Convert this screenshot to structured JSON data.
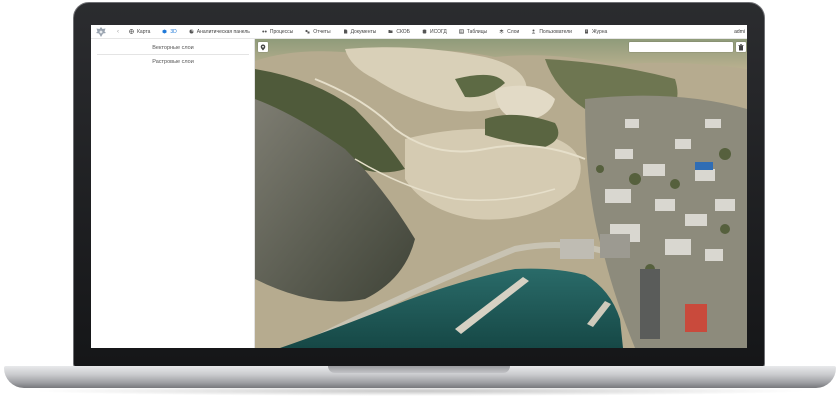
{
  "nav": {
    "items": [
      {
        "label": "Карта",
        "icon": "globe-icon",
        "active": false
      },
      {
        "label": "3D",
        "icon": "cube-icon",
        "active": true
      },
      {
        "label": "Аналитическая панель",
        "icon": "chart-icon",
        "active": false
      },
      {
        "label": "Процессы",
        "icon": "process-icon",
        "active": false
      },
      {
        "label": "Отчеты",
        "icon": "report-icon",
        "active": false
      },
      {
        "label": "Документы",
        "icon": "document-icon",
        "active": false
      },
      {
        "label": "СКОБ",
        "icon": "folder-icon",
        "active": false
      },
      {
        "label": "ИСОГД",
        "icon": "database-icon",
        "active": false
      },
      {
        "label": "Таблицы",
        "icon": "table-icon",
        "active": false
      },
      {
        "label": "Слои",
        "icon": "layers-icon",
        "active": false
      },
      {
        "label": "Пользователи",
        "icon": "users-icon",
        "active": false
      },
      {
        "label": "Журна",
        "icon": "journal-icon",
        "active": false
      }
    ],
    "user": "admi"
  },
  "sidebar": {
    "items": [
      {
        "label": "Векторные слои"
      },
      {
        "label": "Растровые слои"
      }
    ]
  },
  "colors": {
    "accent": "#1e78d8",
    "water": "#1f5b5a",
    "roof_red": "#c94a3c",
    "roof_blue": "#2f6db5"
  }
}
